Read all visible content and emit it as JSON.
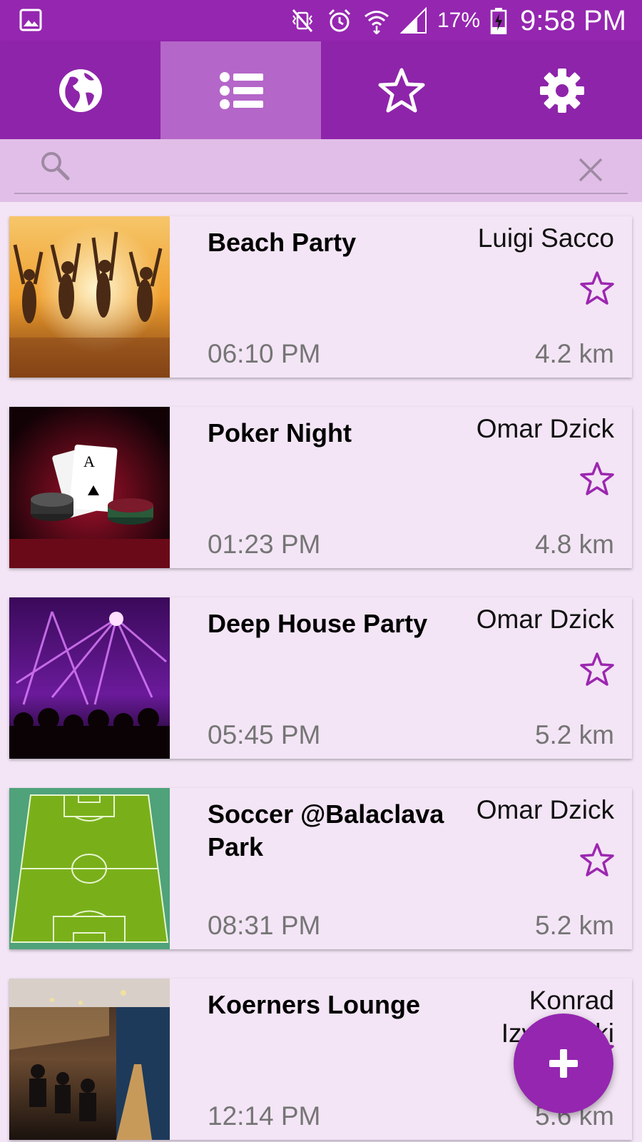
{
  "status_bar": {
    "battery": "17%",
    "time": "9:58 PM"
  },
  "tabs": [
    {
      "icon": "globe-icon",
      "active": false
    },
    {
      "icon": "list-icon",
      "active": true
    },
    {
      "icon": "star-icon",
      "active": false
    },
    {
      "icon": "gear-icon",
      "active": false
    }
  ],
  "search": {
    "value": "",
    "placeholder": ""
  },
  "events": [
    {
      "title": "Beach Party",
      "host": "Luigi Sacco",
      "time": "06:10 PM",
      "distance": "4.2 km",
      "favorite": false,
      "image": "beach-party-photo"
    },
    {
      "title": "Poker Night",
      "host": "Omar Dzick",
      "time": "01:23 PM",
      "distance": "4.8 km",
      "favorite": false,
      "image": "poker-cards-photo"
    },
    {
      "title": "Deep House Party",
      "host": "Omar Dzick",
      "time": "05:45 PM",
      "distance": "5.2 km",
      "favorite": false,
      "image": "club-lights-photo"
    },
    {
      "title": "Soccer @Balaclava Park",
      "host": "Omar Dzick",
      "time": "08:31 PM",
      "distance": "5.2 km",
      "favorite": false,
      "image": "soccer-field-image"
    },
    {
      "title": "Koerners Lounge",
      "host": "Konrad Izykowski",
      "time": "12:14 PM",
      "distance": "5.6 km",
      "favorite": false,
      "image": "lounge-interior-photo"
    }
  ],
  "fab": {
    "icon": "plus-icon"
  },
  "colors": {
    "primary": "#8e24aa",
    "status_bar": "#9526b0",
    "active_tab": "#b566c9",
    "search_bg": "#e1bee7",
    "card_bg": "#f3e5f5",
    "star": "#9c27b0"
  }
}
